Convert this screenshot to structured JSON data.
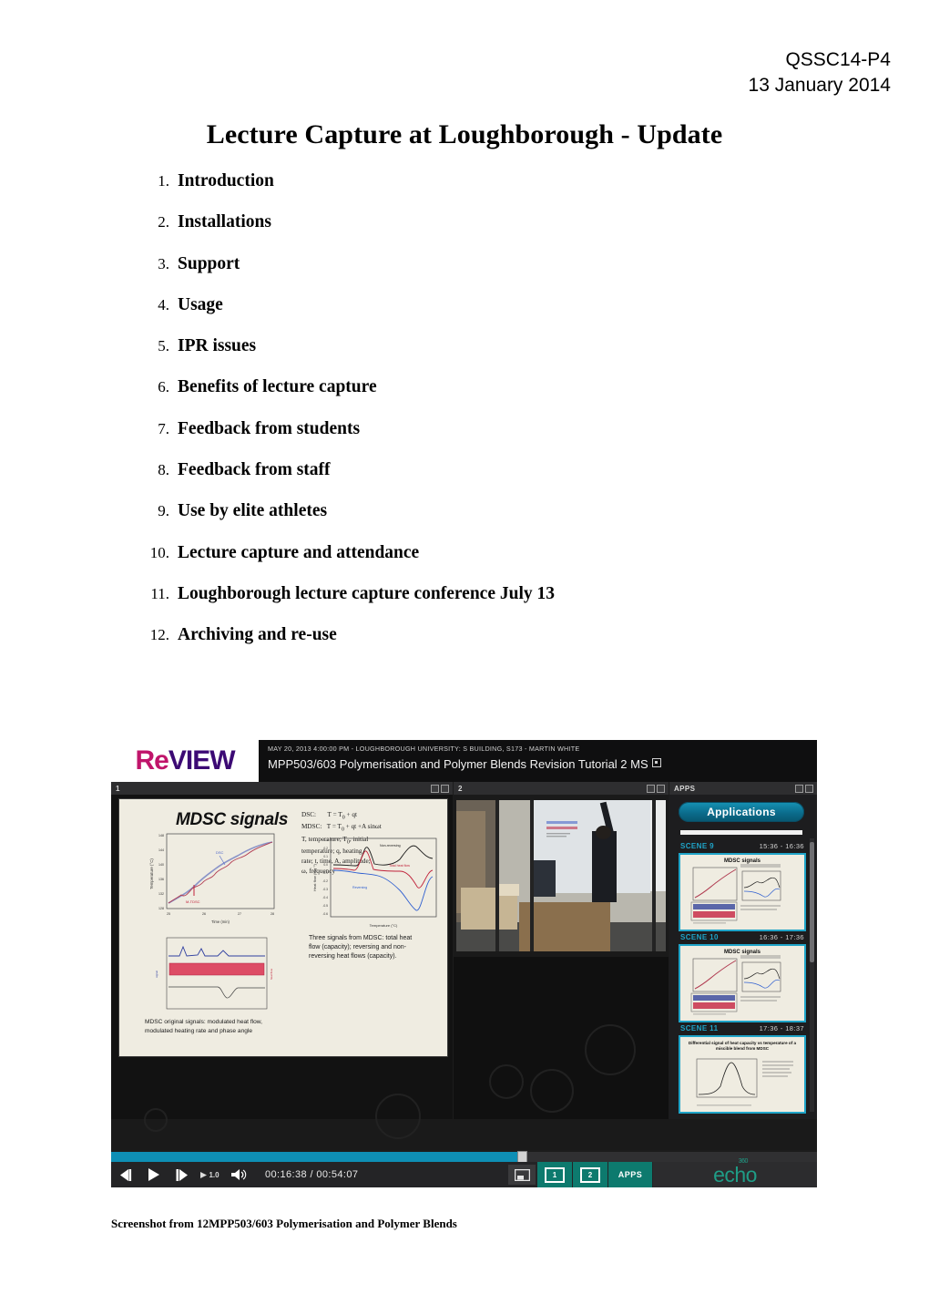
{
  "header": {
    "doc_code": "QSSC14-P4",
    "date": "13 January 2014",
    "title": "Lecture Capture at Loughborough - Update"
  },
  "agenda": {
    "items": [
      {
        "num": "1.",
        "label": "Introduction"
      },
      {
        "num": "2.",
        "label": "Installations"
      },
      {
        "num": "3.",
        "label": "Support"
      },
      {
        "num": "4.",
        "label": "Usage"
      },
      {
        "num": "5.",
        "label": "IPR issues"
      },
      {
        "num": "6.",
        "label": "Benefits of lecture capture"
      },
      {
        "num": "7.",
        "label": "Feedback from students"
      },
      {
        "num": "8.",
        "label": "Feedback from staff"
      },
      {
        "num": "9.",
        "label": "Use by elite athletes"
      },
      {
        "num": "10.",
        "label": "Lecture capture and attendance"
      },
      {
        "num": "11.",
        "label": "Loughborough lecture capture conference July 13"
      },
      {
        "num": "12.",
        "label": "Archiving and re-use"
      }
    ]
  },
  "figure": {
    "caption": "Screenshot from 12MPP503/603 Polymerisation and Polymer Blends",
    "banner": {
      "logo_re": "Re",
      "logo_view": "VIEW",
      "meta_line": "MAY 20, 2013 4:00:00 PM - LOUGHBOROUGH UNIVERSITY: S BUILDING, S173 - MARTIN WHITE",
      "session_title": "MPP503/603 Polymerisation and Polymer Blends Revision Tutorial 2 MS"
    },
    "panel_headers": {
      "panel1": "1",
      "panel2": "2",
      "panel3": "APPS"
    },
    "slide": {
      "title": "MDSC signals",
      "equations": "DSC:       T = T₀ + qt\nMDSC:   T = T₀ + qt +A sinωt\nT, temperature; T0, initial temperature; q, heating rate; t, time, A, amplitude; ω, frequency",
      "note_top_right": "Three signals from MDSC: total heat flow (capacity); reversing and non-reversing heat flows (capacity).",
      "note_bottom_left": "MDSC original signals: modulated heat flow, modulated heating rate and phase angle",
      "chartA": {
        "ylabel": "Temperature (°C)",
        "xlabel": "Time (min)",
        "yticks": [
          "148",
          "144",
          "140",
          "136",
          "132",
          "128"
        ],
        "xticks": [
          "25",
          "26",
          "27",
          "28"
        ],
        "series_labels": [
          "DSC",
          "M-TDSC"
        ]
      },
      "chartB": {
        "ylabel": "Heat flow (Wg⁻¹)",
        "xlabel": "Temperature (°C)",
        "yticks": [
          "0.3",
          "0.2",
          "0.1",
          "0.0",
          "-0.1",
          "-0.2",
          "-0.3",
          "-0.4",
          "-0.5",
          "-0.6"
        ],
        "series_labels": [
          "Non-reversing",
          "Total heat flow",
          "Reversing"
        ]
      }
    },
    "apps": {
      "button_label": "Applications",
      "scenes": [
        {
          "name": "SCENE 9",
          "time": "15:36 - 16:36",
          "thumb_title": "MDSC signals"
        },
        {
          "name": "SCENE 10",
          "time": "16:36 - 17:36",
          "thumb_title": "MDSC signals"
        },
        {
          "name": "SCENE 11",
          "time": "17:36 - 18:37",
          "thumb_title": "Differential signal of heat capacity vs temperature of a miscible blend from MDSC"
        }
      ]
    },
    "player": {
      "current_time": "00:16:38",
      "total_time": "00:54:07",
      "time_display": "00:16:38 / 00:54:07",
      "speed": "1.0",
      "progress_percent": 58,
      "buttons": {
        "prev_frame": "prev-frame",
        "play": "play",
        "next_frame": "next-frame",
        "volume": "volume",
        "layout": "layout",
        "view_1": "1",
        "view_2": "2",
        "view_apps": "APPS"
      },
      "brand": "echo",
      "brand_sup": "360"
    },
    "colors": {
      "accent_teal": "#0e8fb5",
      "scene_label": "#1fa4c8",
      "echo_green": "#1f9c86",
      "logo_magenta": "#c0156b",
      "logo_purple": "#3c0a74"
    }
  }
}
